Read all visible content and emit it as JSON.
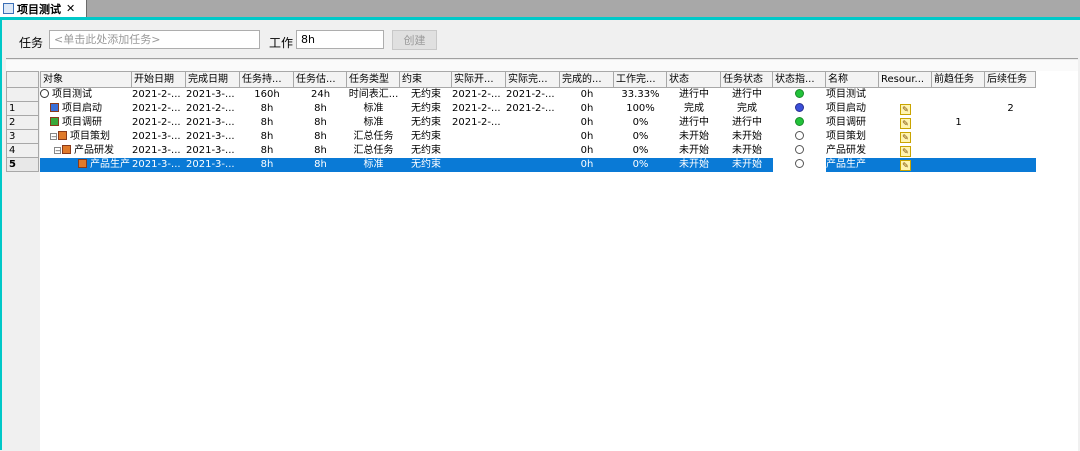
{
  "tab": {
    "title": "项目测试",
    "close": "✕"
  },
  "form": {
    "task_label": "任务",
    "task_placeholder": "<单击此处添加任务>",
    "work_label": "工作",
    "work_value": "8h",
    "create_button": "创建"
  },
  "columns": [
    "对象",
    "开始日期",
    "完成日期",
    "任务持...",
    "任务估...",
    "任务类型",
    "约束",
    "实际开...",
    "实际完...",
    "完成的...",
    "工作完...",
    "状态",
    "任务状态",
    "状态指...",
    "名称",
    "Resour...",
    "前趋任务",
    "后续任务"
  ],
  "row_numbers": [
    "1",
    "2",
    "3",
    "4",
    "5"
  ],
  "rows": [
    {
      "num": "",
      "name": "项目测试",
      "start": "2021-2-...",
      "finish": "2021-3-...",
      "duration": "160h",
      "estimate": "24h",
      "type": "时间表汇...",
      "constraint": "无约束",
      "actual_start": "2021-2-...",
      "actual_finish": "2021-2-...",
      "done": "0h",
      "work_pct": "33.33%",
      "status": "进行中",
      "task_status": "进行中",
      "indicator": "green",
      "label_name": "项目测试",
      "resource": "",
      "pred": "",
      "succ": ""
    },
    {
      "num": "1",
      "name": "项目启动",
      "start": "2021-2-...",
      "finish": "2021-2-...",
      "duration": "8h",
      "estimate": "8h",
      "type": "标准",
      "constraint": "无约束",
      "actual_start": "2021-2-...",
      "actual_finish": "2021-2-...",
      "done": "0h",
      "work_pct": "100%",
      "status": "完成",
      "task_status": "完成",
      "indicator": "blue",
      "label_name": "项目启动",
      "resource": "pen",
      "pred": "",
      "succ": "2"
    },
    {
      "num": "2",
      "name": "项目调研",
      "start": "2021-2-...",
      "finish": "2021-3-...",
      "duration": "8h",
      "estimate": "8h",
      "type": "标准",
      "constraint": "无约束",
      "actual_start": "2021-2-...",
      "actual_finish": "",
      "done": "0h",
      "work_pct": "0%",
      "status": "进行中",
      "task_status": "进行中",
      "indicator": "green",
      "label_name": "项目调研",
      "resource": "pen",
      "pred": "1",
      "succ": ""
    },
    {
      "num": "3",
      "name": "项目策划",
      "start": "2021-3-...",
      "finish": "2021-3-...",
      "duration": "8h",
      "estimate": "8h",
      "type": "汇总任务",
      "constraint": "无约束",
      "actual_start": "",
      "actual_finish": "",
      "done": "0h",
      "work_pct": "0%",
      "status": "未开始",
      "task_status": "未开始",
      "indicator": "empty",
      "label_name": "项目策划",
      "resource": "pen",
      "pred": "",
      "succ": ""
    },
    {
      "num": "4",
      "name": "产品研发",
      "start": "2021-3-...",
      "finish": "2021-3-...",
      "duration": "8h",
      "estimate": "8h",
      "type": "汇总任务",
      "constraint": "无约束",
      "actual_start": "",
      "actual_finish": "",
      "done": "0h",
      "work_pct": "0%",
      "status": "未开始",
      "task_status": "未开始",
      "indicator": "empty",
      "label_name": "产品研发",
      "resource": "pen",
      "pred": "",
      "succ": ""
    },
    {
      "num": "5",
      "name": "产品生产",
      "start": "2021-3-...",
      "finish": "2021-3-...",
      "duration": "8h",
      "estimate": "8h",
      "type": "标准",
      "constraint": "无约束",
      "actual_start": "",
      "actual_finish": "",
      "done": "0h",
      "work_pct": "0%",
      "status": "未开始",
      "task_status": "未开始",
      "indicator": "empty",
      "label_name": "产品生产",
      "resource": "pen",
      "pred": "",
      "succ": ""
    }
  ],
  "colors": {
    "accent": "#00c8c8",
    "selection": "#0a7ad6",
    "green": "#22c23a",
    "blue": "#3a4fd8"
  }
}
